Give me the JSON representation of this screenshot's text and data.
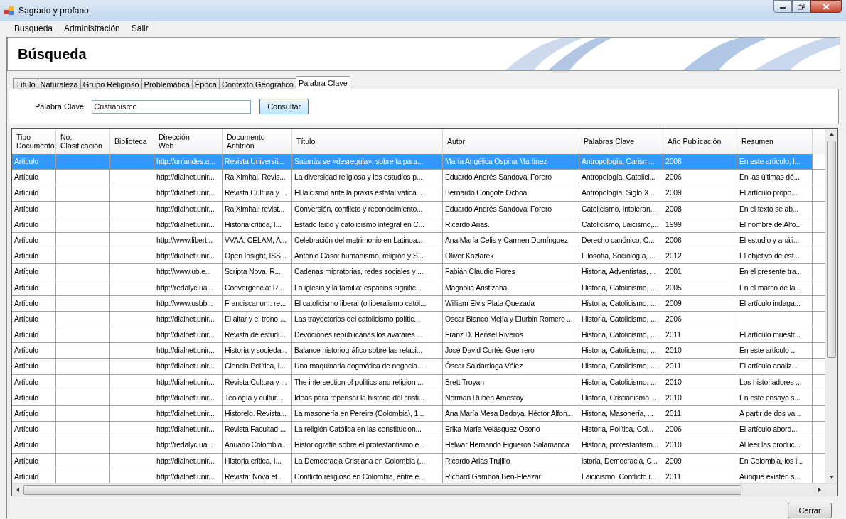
{
  "window": {
    "title": "Sagrado y profano"
  },
  "menu": [
    "Busqueda",
    "Administración",
    "Salir"
  ],
  "header": {
    "title": "Búsqueda"
  },
  "tabs": [
    {
      "label": "Título",
      "selected": false
    },
    {
      "label": "Naturaleza",
      "selected": false
    },
    {
      "label": "Grupo Religioso",
      "selected": false
    },
    {
      "label": "Problemática",
      "selected": false
    },
    {
      "label": "Época",
      "selected": false
    },
    {
      "label": "Contexto Geográfico",
      "selected": false
    },
    {
      "label": "Palabra Clave",
      "selected": true
    }
  ],
  "search": {
    "label": "Palabra Clave:",
    "value": "Cristianismo",
    "button": "Consultar"
  },
  "table": {
    "columns": [
      "Tipo\nDocumento",
      "No.\nClasificación",
      "Biblioteca",
      "Dirección\nWeb",
      "Documento\nAnfitrión",
      "Título",
      "Autor",
      "Palabras Clave",
      "Año Publicación",
      "Resumen"
    ],
    "rows": [
      {
        "selected": true,
        "tipo_documento": "Artículo",
        "direccion_web": "http://uniandes.a...",
        "documento_anfitrion": "Revista Universit...",
        "titulo": "Satanás se «desregula»: sobre la para...",
        "autor": "María Angélica Ospina Martínez",
        "palabras_clave": "Antropología, Carism...",
        "anio": "2006",
        "resumen": "En este artículo, l..."
      },
      {
        "selected": false,
        "tipo_documento": "Artículo",
        "direccion_web": "http://dialnet.unir...",
        "documento_anfitrion": "Ra Ximhai. Revis...",
        "titulo": "La diversidad religiosa y los estudios p...",
        "autor": "Eduardo Andrés Sandoval Forero",
        "palabras_clave": "Antropología, Catolici...",
        "anio": "2006",
        "resumen": "En las últimas dé..."
      },
      {
        "selected": false,
        "tipo_documento": "Artículo",
        "direccion_web": "http://dialnet.unir...",
        "documento_anfitrion": "Revista Cultura y ...",
        "titulo": "El laicismo ante la praxis estatal vatica...",
        "autor": "Bernardo Congote Ochoa",
        "palabras_clave": "Antropología, Siglo X...",
        "anio": "2009",
        "resumen": "El artículo propo..."
      },
      {
        "selected": false,
        "tipo_documento": "Artículo",
        "direccion_web": "http://dialnet.unir...",
        "documento_anfitrion": "Ra Ximhai: revist...",
        "titulo": "Conversión, conflicto y reconocimiento...",
        "autor": "Eduardo Andrés Sandoval Forero",
        "palabras_clave": "Catolicismo, Intoleran...",
        "anio": "2008",
        "resumen": "En el texto se ab..."
      },
      {
        "selected": false,
        "tipo_documento": "Artículo",
        "direccion_web": "http://dialnet.unir...",
        "documento_anfitrion": "Historia crítica, I...",
        "titulo": "Estado laico y catolicismo integral en C...",
        "autor": "Ricardo Arias.",
        "palabras_clave": "Catolicismo, Laicismo,...",
        "anio": "1999",
        "resumen": "El nombre de Alfo..."
      },
      {
        "selected": false,
        "tipo_documento": "Artículo",
        "direccion_web": "http://www.libert...",
        "documento_anfitrion": "VVAA, CELAM, A...",
        "titulo": "Celebración del matrimonio en Latinoa...",
        "autor": "Ana María Celis y Carmen Domínguez",
        "palabras_clave": "Derecho canónico, C...",
        "anio": "2006",
        "resumen": "El estudio y análi..."
      },
      {
        "selected": false,
        "tipo_documento": "Artículo",
        "direccion_web": "http://dialnet.unir...",
        "documento_anfitrion": "Open Insight, ISS...",
        "titulo": "Antonio Caso: humanismo, religión y S...",
        "autor": "Oliver Kozlarek",
        "palabras_clave": "Filosofía, Sociología, ...",
        "anio": "2012",
        "resumen": "El objetivo de est..."
      },
      {
        "selected": false,
        "tipo_documento": "Artículo",
        "direccion_web": "http://www.ub.e...",
        "documento_anfitrion": "Scripta Nova.  R...",
        "titulo": "Cadenas migratorias, redes sociales y ...",
        "autor": "Fabián Claudio Flores",
        "palabras_clave": "Historia, Adventistas, ...",
        "anio": "2001",
        "resumen": "En el presente tra..."
      },
      {
        "selected": false,
        "tipo_documento": "Artículo",
        "direccion_web": "http://redalyc.ua...",
        "documento_anfitrion": "Convergencia: R...",
        "titulo": "La iglesia y la familia: espacios signific...",
        "autor": "Magnolia Aristizabal",
        "palabras_clave": "Historia, Catolicismo, ...",
        "anio": "2005",
        "resumen": "En el marco de la..."
      },
      {
        "selected": false,
        "tipo_documento": "Artículo",
        "direccion_web": "http://www.usbb...",
        "documento_anfitrion": "Franciscanum: re...",
        "titulo": "El catolicismo liberal (o liberalismo catól...",
        "autor": "William Elvis Plata Quezada",
        "palabras_clave": "Historia, Catolicismo, ...",
        "anio": "2009",
        "resumen": "El artículo indaga..."
      },
      {
        "selected": false,
        "tipo_documento": "Artículo",
        "direccion_web": "http://dialnet.unir...",
        "documento_anfitrion": "El altar y el trono ...",
        "titulo": "Las trayectorias del catolicismo polític...",
        "autor": "Oscar Blanco Mejía y Elurbin Romero ...",
        "palabras_clave": "Historia, Catolicismo, ...",
        "anio": "2006"
      },
      {
        "selected": false,
        "tipo_documento": "Artículo",
        "direccion_web": "http://dialnet.unir...",
        "documento_anfitrion": "Revista de estudi...",
        "titulo": "Devociones republicanas los avatares ...",
        "autor": "Franz D. Hensel Riveros",
        "palabras_clave": "Historia, Catolicismo, ...",
        "anio": "2011",
        "resumen": "El artículo muestr..."
      },
      {
        "selected": false,
        "tipo_documento": "Artículo",
        "direccion_web": "http://dialnet.unir...",
        "documento_anfitrion": "Historia y socieda...",
        "titulo": "Balance historiográfico sobre las relaci...",
        "autor": "José David Cortés Guerrero",
        "palabras_clave": "Historia, Catolicismo, ...",
        "anio": "2010",
        "resumen": "En este artículo ..."
      },
      {
        "selected": false,
        "tipo_documento": "Artículo",
        "direccion_web": "http://dialnet.unir...",
        "documento_anfitrion": "Ciencia Política, I...",
        "titulo": "Una maquinaria dogmática de negocia...",
        "autor": "Óscar Saldarriaga Vélez",
        "palabras_clave": "Historia, Catolicismo, ...",
        "anio": "2011",
        "resumen": "El artículo analiz..."
      },
      {
        "selected": false,
        "tipo_documento": "Artículo",
        "direccion_web": "http://dialnet.unir...",
        "documento_anfitrion": "Revista Cultura y ...",
        "titulo": "The intersection of politics and religion ...",
        "autor": "Brett Troyan",
        "palabras_clave": "Historia, Catolicismo, ...",
        "anio": "2010",
        "resumen": "Los historiadores ..."
      },
      {
        "selected": false,
        "tipo_documento": "Artículo",
        "direccion_web": "http://dialnet.unir...",
        "documento_anfitrion": "Teología y cultur...",
        "titulo": "Ideas para repensar la historia del cristi...",
        "autor": "Norman Rubén Amestoy",
        "palabras_clave": "Historia, Cristianismo, ...",
        "anio": "2010",
        "resumen": "En este ensayo s..."
      },
      {
        "selected": false,
        "tipo_documento": "Artículo",
        "direccion_web": "http://dialnet.unir...",
        "documento_anfitrion": "Historelo. Revista...",
        "titulo": "La masonería en Pereira (Colombia), 1...",
        "autor": "Ana María Mesa Bedoya, Héctor Alfon...",
        "palabras_clave": "Historia, Masonería, ...",
        "anio": "2011",
        "resumen": "A partir de dos va..."
      },
      {
        "selected": false,
        "tipo_documento": "Artículo",
        "direccion_web": "http://dialnet.unir...",
        "documento_anfitrion": "Revista Facultad ...",
        "titulo": "La religión Católica en las constitucion...",
        "autor": "Erika María Velásquez Osorio",
        "palabras_clave": "Historia, Política, Col...",
        "anio": "2006",
        "resumen": "El artículo abord..."
      },
      {
        "selected": false,
        "tipo_documento": "Artículo",
        "direccion_web": "http://redalyc.ua...",
        "documento_anfitrion": "Anuario Colombia...",
        "titulo": "Historiografía sobre el protestantismo e...",
        "autor": "Helwar Hernando Figueroa Salamanca",
        "palabras_clave": "Historia, protestantism...",
        "anio": "2010",
        "resumen": "Al leer las produc..."
      },
      {
        "selected": false,
        "tipo_documento": "Artículo",
        "direccion_web": "http://dialnet.unir...",
        "documento_anfitrion": "Historia crítica, I...",
        "titulo": "La Democracia Cristiana en Colombia (...",
        "autor": "Ricardo Arias Trujillo",
        "palabras_clave": "istoria, Democracia, C...",
        "anio": "2009",
        "resumen": "En Colombia, los i..."
      },
      {
        "selected": false,
        "tipo_documento": "Artículo",
        "direccion_web": "http://dialnet.unir...",
        "documento_anfitrion": "Revista: Nova et ...",
        "titulo": "Conflicto religioso en Colombia, entre e...",
        "autor": "Richard Gamboa Ben-Eleázar",
        "palabras_clave": "Laicicismo, Conflicto r...",
        "anio": "2011",
        "resumen": "Aunque existen s..."
      }
    ]
  },
  "close_button": "Cerrar"
}
